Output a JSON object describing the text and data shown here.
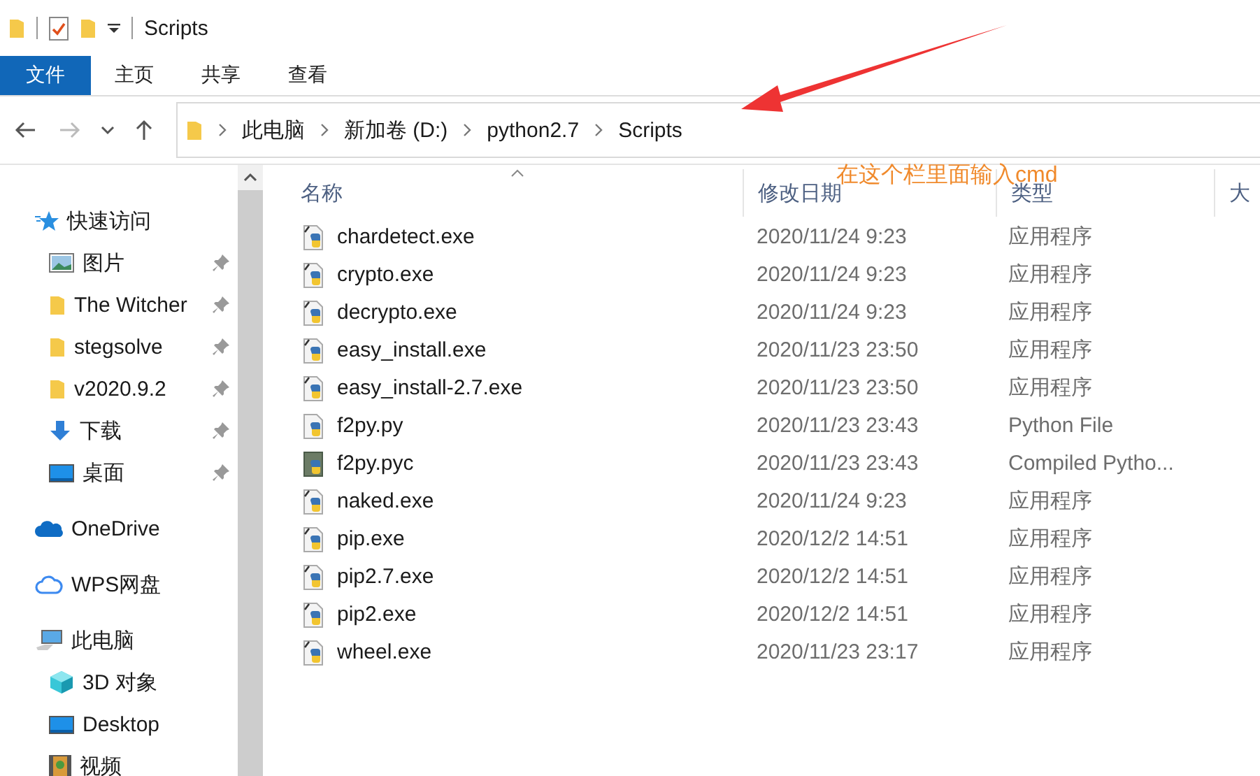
{
  "window": {
    "title": "Scripts"
  },
  "ribbon_tabs": [
    {
      "label": "文件",
      "selected": true
    },
    {
      "label": "主页",
      "selected": false
    },
    {
      "label": "共享",
      "selected": false
    },
    {
      "label": "查看",
      "selected": false
    }
  ],
  "navigation": {
    "forward_disabled": true
  },
  "address_bar": {
    "path": [
      "此电脑",
      "新加卷 (D:)",
      "python2.7",
      "Scripts"
    ]
  },
  "sidebar": {
    "groups": [
      {
        "label": "快速访问",
        "kind": "star",
        "children": [
          {
            "label": "图片",
            "kind": "pictures",
            "pinned": true
          },
          {
            "label": "The Witcher",
            "kind": "folder",
            "pinned": true
          },
          {
            "label": "stegsolve",
            "kind": "folder",
            "pinned": true
          },
          {
            "label": "v2020.9.2",
            "kind": "folder",
            "pinned": true
          },
          {
            "label": "下载",
            "kind": "download",
            "pinned": true
          },
          {
            "label": "桌面",
            "kind": "desktop",
            "pinned": true
          }
        ]
      },
      {
        "label": "OneDrive",
        "kind": "onedrive"
      },
      {
        "label": "WPS网盘",
        "kind": "wps"
      },
      {
        "label": "此电脑",
        "kind": "pc",
        "children": [
          {
            "label": "3D 对象",
            "kind": "cube",
            "pinned": false
          },
          {
            "label": "Desktop",
            "kind": "desktop",
            "pinned": false
          },
          {
            "label": "视频",
            "kind": "video",
            "pinned": false
          }
        ]
      }
    ]
  },
  "file_list": {
    "columns": [
      "名称",
      "修改日期",
      "类型",
      "大"
    ],
    "rows": [
      {
        "name": "chardetect.exe",
        "kind": "exe",
        "date": "2020/11/24 9:23",
        "type": "应用程序"
      },
      {
        "name": "crypto.exe",
        "kind": "exe",
        "date": "2020/11/24 9:23",
        "type": "应用程序"
      },
      {
        "name": "decrypto.exe",
        "kind": "exe",
        "date": "2020/11/24 9:23",
        "type": "应用程序"
      },
      {
        "name": "easy_install.exe",
        "kind": "exe",
        "date": "2020/11/23 23:50",
        "type": "应用程序"
      },
      {
        "name": "easy_install-2.7.exe",
        "kind": "exe",
        "date": "2020/11/23 23:50",
        "type": "应用程序"
      },
      {
        "name": "f2py.py",
        "kind": "py",
        "date": "2020/11/23 23:43",
        "type": "Python File"
      },
      {
        "name": "f2py.pyc",
        "kind": "pyc",
        "date": "2020/11/23 23:43",
        "type": "Compiled Pytho..."
      },
      {
        "name": "naked.exe",
        "kind": "exe",
        "date": "2020/11/24 9:23",
        "type": "应用程序"
      },
      {
        "name": "pip.exe",
        "kind": "exe",
        "date": "2020/12/2 14:51",
        "type": "应用程序"
      },
      {
        "name": "pip2.7.exe",
        "kind": "exe",
        "date": "2020/12/2 14:51",
        "type": "应用程序"
      },
      {
        "name": "pip2.exe",
        "kind": "exe",
        "date": "2020/12/2 14:51",
        "type": "应用程序"
      },
      {
        "name": "wheel.exe",
        "kind": "exe",
        "date": "2020/11/23 23:17",
        "type": "应用程序"
      }
    ]
  },
  "annotation": {
    "text": "在这个栏里面输入cmd"
  }
}
